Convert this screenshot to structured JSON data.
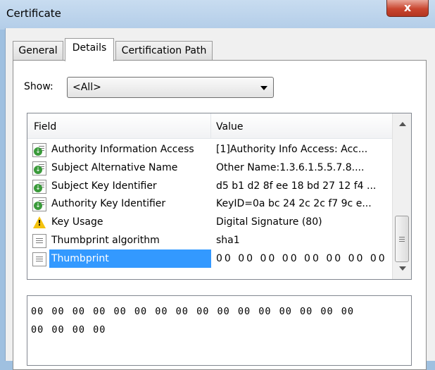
{
  "window": {
    "title": "Certificate",
    "close_glyph": "x"
  },
  "tabs": [
    {
      "label": "General",
      "active": false
    },
    {
      "label": "Details",
      "active": true
    },
    {
      "label": "Certification Path",
      "active": false
    }
  ],
  "show": {
    "label": "Show:",
    "value": "<All>"
  },
  "fields_table": {
    "columns": [
      "Field",
      "Value"
    ],
    "rows": [
      {
        "field": "Authority Information Access",
        "value": "[1]Authority Info Access: Acc...",
        "icon": "certificate-extension-icon"
      },
      {
        "field": "Subject Alternative Name",
        "value": "Other Name:1.3.6.1.5.5.7.8....",
        "icon": "certificate-extension-icon"
      },
      {
        "field": "Subject Key Identifier",
        "value": "d5 b1 d2 8f ee 18 bd 27 12 f4 ...",
        "icon": "certificate-extension-icon"
      },
      {
        "field": "Authority Key Identifier",
        "value": "KeyID=0a bc 24 2c 2c f7 9c e...",
        "icon": "certificate-extension-icon"
      },
      {
        "field": "Key Usage",
        "value": "Digital Signature (80)",
        "icon": "warning-icon"
      },
      {
        "field": "Thumbprint algorithm",
        "value": "sha1",
        "icon": "property-icon"
      },
      {
        "field": "Thumbprint",
        "value": "00 00 00 00 00 00 00 00",
        "icon": "property-icon",
        "selected": true
      }
    ]
  },
  "detail": {
    "line1": "00 00 00 00 00 00 00 00 00 00 00 00 00 00 00 00",
    "line2": "00 00 00 00"
  },
  "colors": {
    "selection": "#3399ff",
    "close_button": "#c9452f"
  }
}
